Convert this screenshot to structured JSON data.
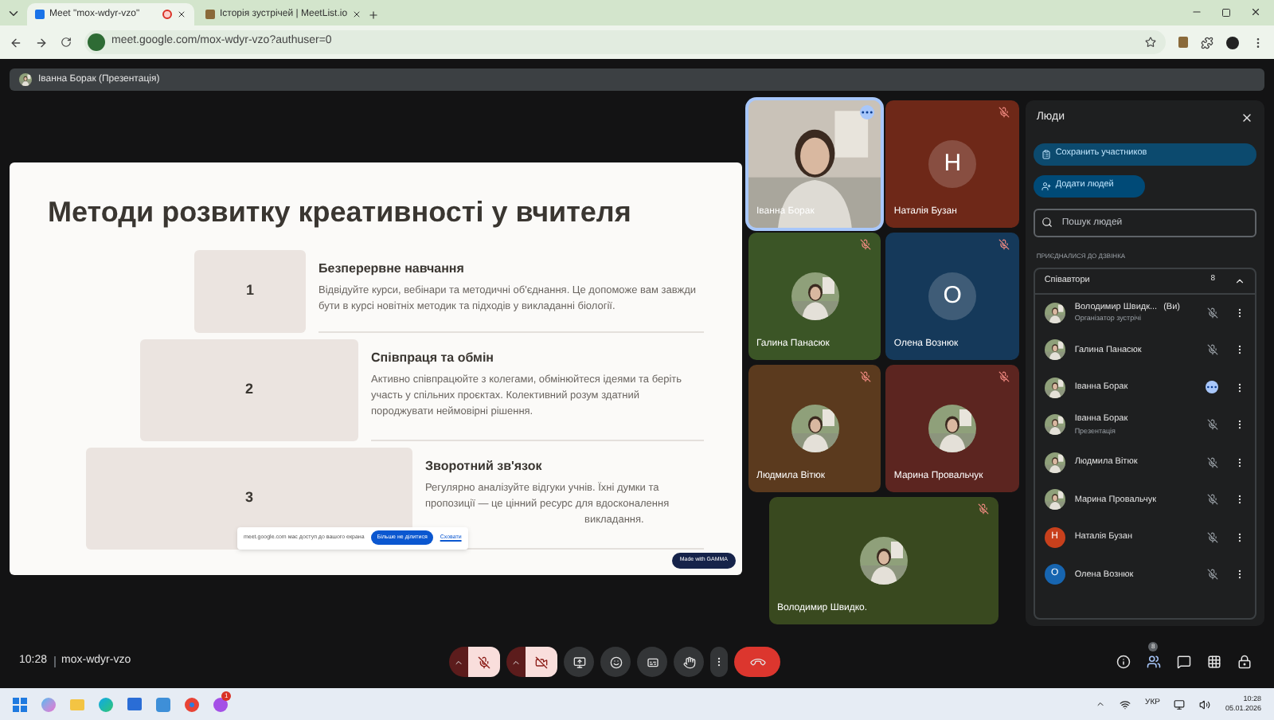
{
  "browser": {
    "tabs": [
      {
        "title": "Meet \"mox-wdyr-vzo\"",
        "selected": true,
        "recording": true
      },
      {
        "title": "Історія зустрічей | MeetList.io",
        "selected": false,
        "recording": false
      }
    ],
    "address": "meet.google.com/mox-wdyr-vzo?authuser=0"
  },
  "presenter_bar": {
    "label": "Іванна Борак (Презентація)"
  },
  "slide": {
    "title": "Методи розвитку креативності у вчителя",
    "steps": [
      {
        "number": "1",
        "heading": "Безперервне навчання",
        "text": "Відвідуйте курси, вебінари та методичні об'єднання. Це допоможе вам завжди бути в курсі новітніх методик та підходів у викладанні біології."
      },
      {
        "number": "2",
        "heading": "Співпраця та обмін",
        "text": "Активно співпрацюйте з колегами, обмінюйтеся ідеями та беріть участь у спільних проєктах. Колективний розум здатний породжувати неймовірні рішення."
      },
      {
        "number": "3",
        "heading": "Зворотний зв'язок",
        "text": "Регулярно аналізуйте відгуки учнів. Їхні думки та пропозиції — це цінний ресурс для вдосконалення",
        "tail": "викладання."
      }
    ],
    "badge": "Made with GAMMA",
    "share_banner": {
      "text": "meet.google.com має доступ до вашого екрана",
      "stop": "Більше не ділитися",
      "hide": "Сховати"
    }
  },
  "tiles": [
    {
      "name": "Іванна Борак",
      "kind": "video",
      "color": "#c9c2b8",
      "muted": false
    },
    {
      "name": "Наталія Бузан",
      "kind": "letter",
      "letter": "Н",
      "color": "#6e2818",
      "muted": true
    },
    {
      "name": "Галина Панасюк",
      "color": "#3b5526",
      "muted": true
    },
    {
      "name": "Олена Вознюк",
      "kind": "letter",
      "letter": "О",
      "color": "#15395a",
      "muted": true
    },
    {
      "name": "Людмила Вітюк",
      "color": "#5b3a1e",
      "muted": true
    },
    {
      "name": "Марина Провальчук",
      "color": "#5c2520",
      "muted": true
    },
    {
      "name": "Володимир Швидко.",
      "color": "#39491f",
      "muted": true
    }
  ],
  "people_panel": {
    "title": "Люди",
    "save_button": "Сохранить участников",
    "add_button": "Додати людей",
    "search": {
      "placeholder": "Пошук людей"
    },
    "section": "ПРИЄДНАЛИСЯ ДО ДЗВІНКА",
    "group": {
      "title": "Співавтори",
      "count": "8",
      "expanded": true
    },
    "people": [
      {
        "name": "Володимир Швидк...",
        "suffix": "(Ви)",
        "role": "Організатор зустрічі",
        "muted": true
      },
      {
        "name": "Галина Панасюк",
        "muted": true
      },
      {
        "name": "Іванна Борак",
        "muted": false
      },
      {
        "name": "Іванна Борак",
        "role": "Презентація",
        "muted": true
      },
      {
        "name": "Людмила Вітюк",
        "muted": true
      },
      {
        "name": "Марина Провальчук",
        "muted": true
      },
      {
        "name": "Наталія Бузан",
        "letter": "Н",
        "color": "#c8401c",
        "muted": true
      },
      {
        "name": "Олена Вознюк",
        "letter": "О",
        "color": "#1765b0",
        "muted": true
      }
    ]
  },
  "bottom_bar": {
    "time": "10:28",
    "code": "mox-wdyr-vzo",
    "mic_on": false,
    "camera_on": false,
    "people_count": "8"
  },
  "taskbar": {
    "language": "УКР",
    "time": "10:28",
    "date": "05.01.2026",
    "notification": "1"
  }
}
